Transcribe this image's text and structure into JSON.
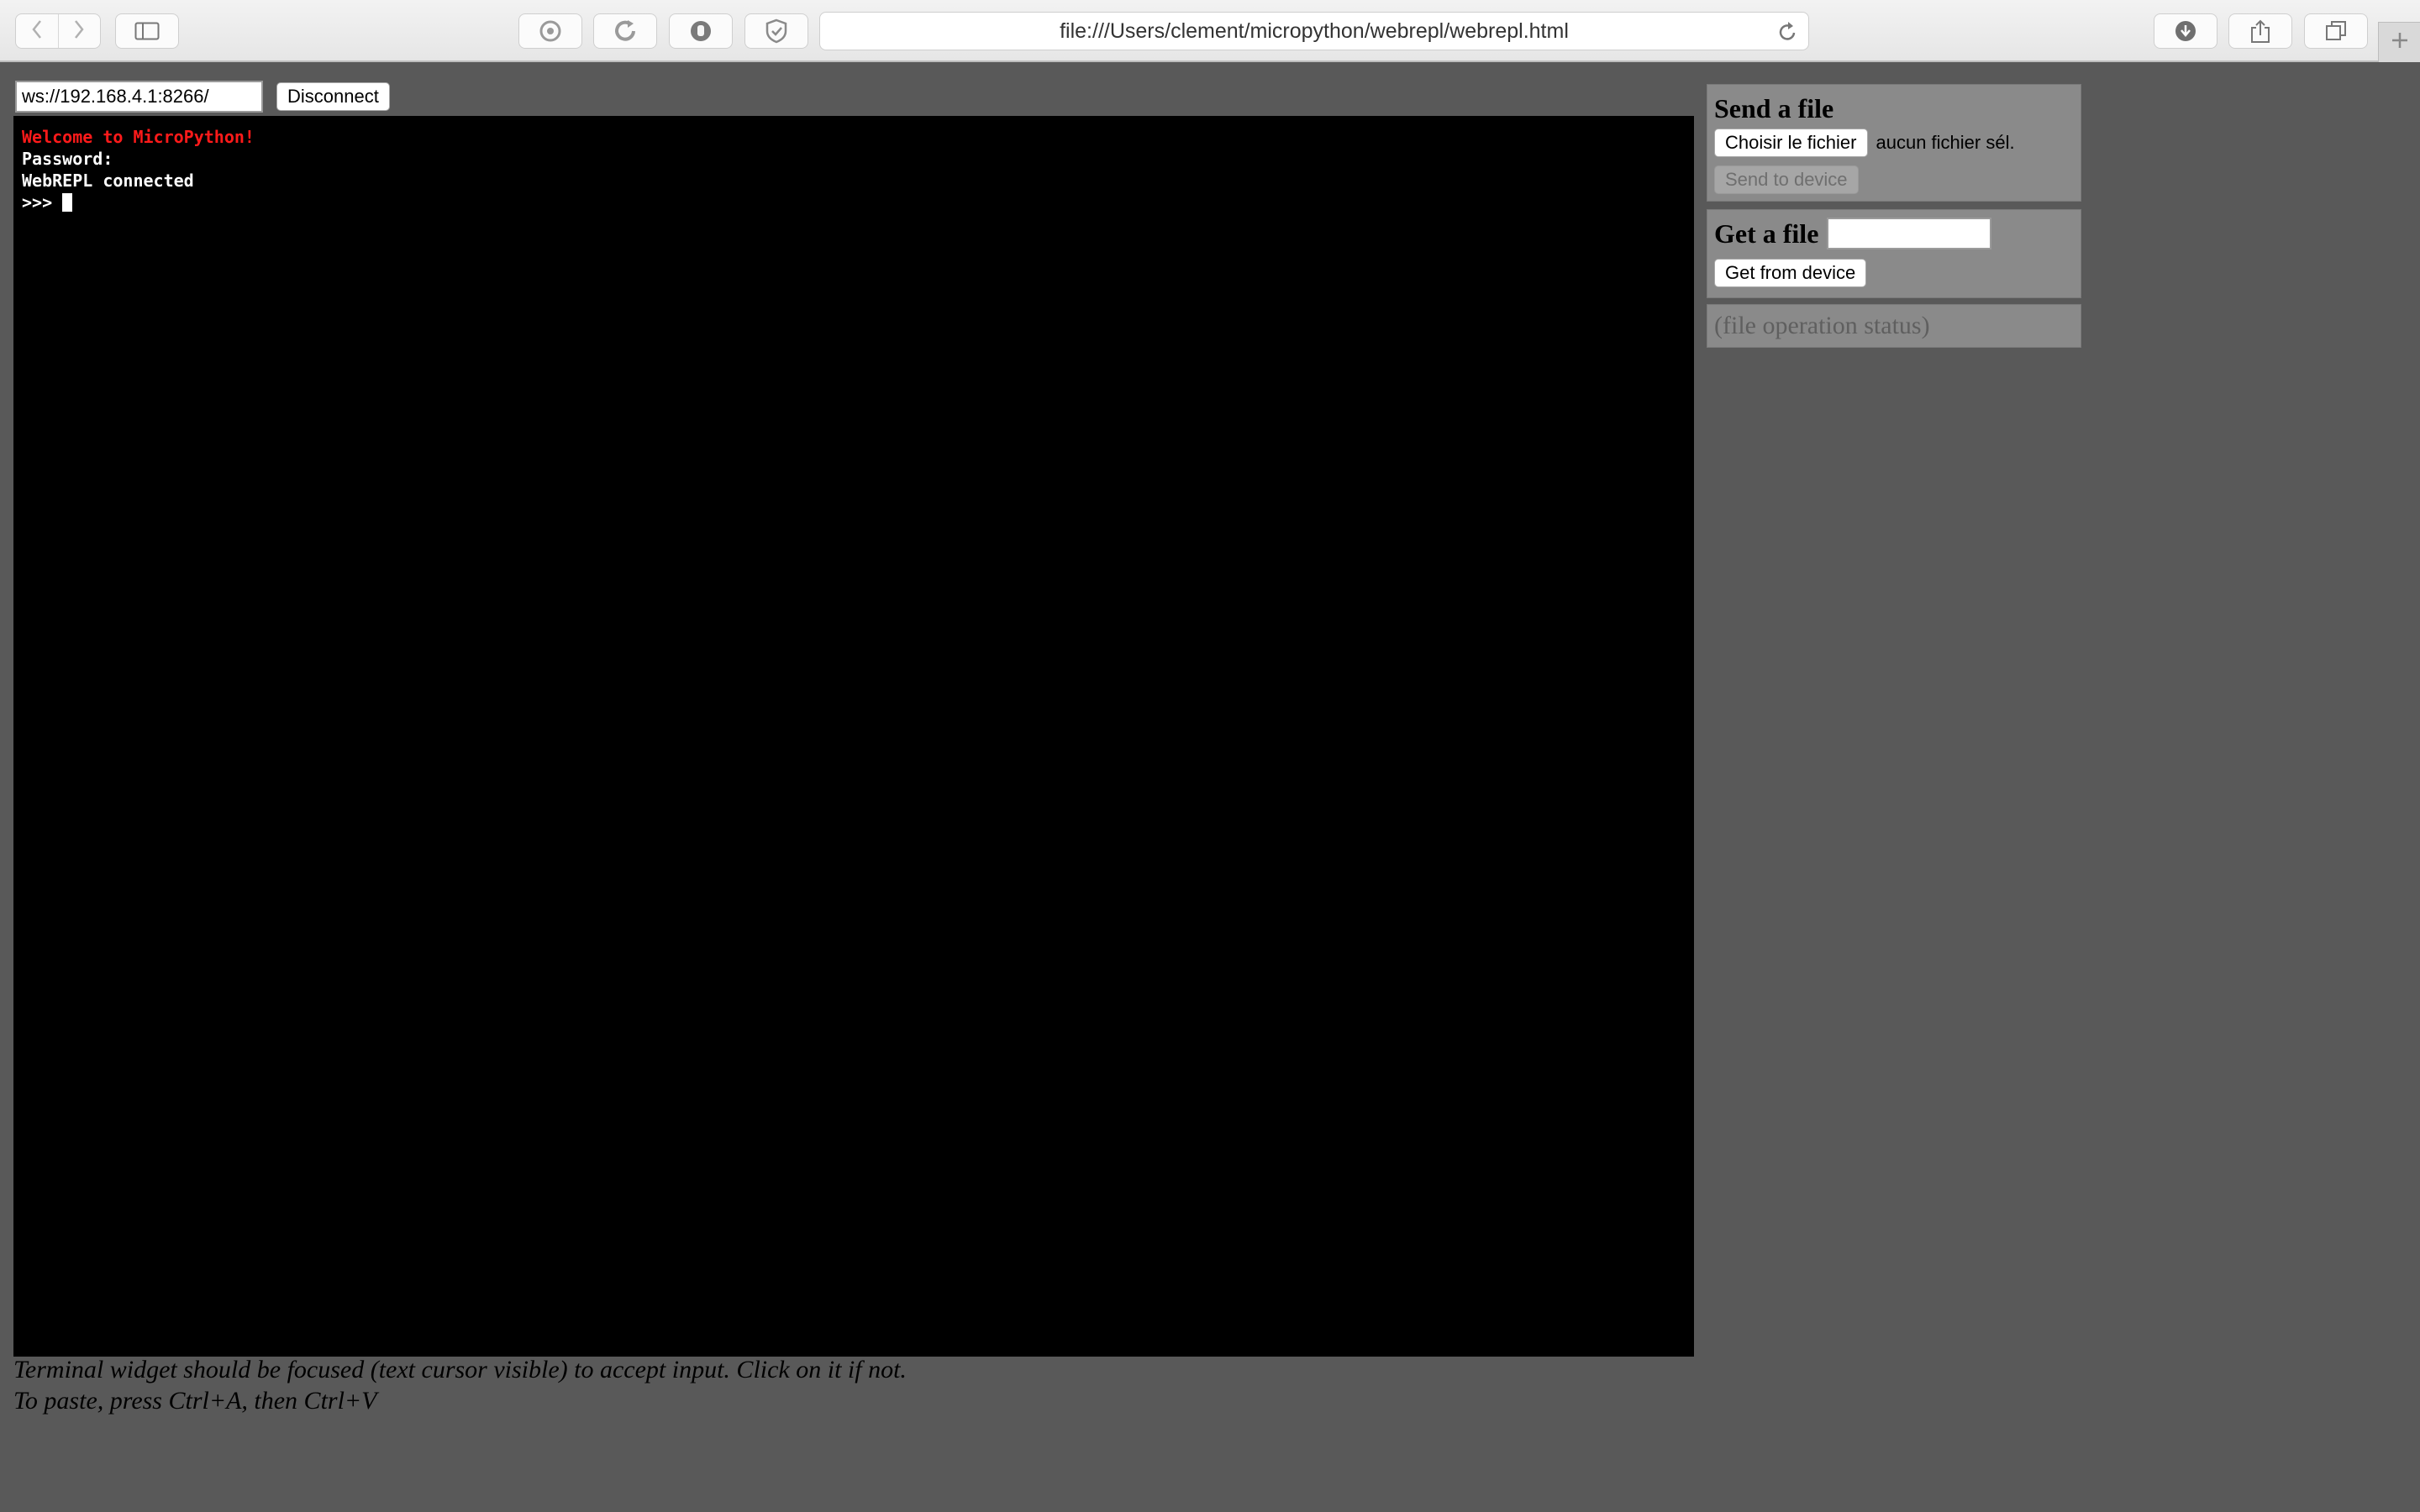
{
  "browser": {
    "url": "file:///Users/clement/micropython/webrepl/webrepl.html",
    "toolbar_icons": {
      "back": "chevron-left-icon",
      "forward": "chevron-right-icon",
      "sidebar": "sidebar-icon",
      "ext1": "target-icon",
      "ext2": "refresh-circle-icon",
      "ext3": "hand-icon",
      "ext4": "shield-icon",
      "reload": "reload-icon",
      "download": "download-icon",
      "share": "share-icon",
      "tabs": "tabs-icon",
      "new_tab": "plus-icon"
    }
  },
  "connection": {
    "ws_url": "ws://192.168.4.1:8266/",
    "connect_button_label": "Disconnect"
  },
  "terminal": {
    "lines": [
      "Welcome to MicroPython!",
      "Password:",
      "WebREPL connected",
      ">>> "
    ],
    "colors": {
      "welcome": "#ff1a1a",
      "text": "#ffffff",
      "background": "#000000"
    }
  },
  "notes": {
    "line1": "Terminal widget should be focused (text cursor visible) to accept input. Click on it if not.",
    "line2": "To paste, press Ctrl+A, then Ctrl+V"
  },
  "send_file": {
    "title": "Send a file",
    "choose_label": "Choisir le fichier",
    "no_file_text": "aucun fichier sél.",
    "send_button_label": "Send to device"
  },
  "get_file": {
    "title": "Get a file",
    "filename_value": "",
    "get_button_label": "Get from device"
  },
  "status": {
    "text": "(file operation status)"
  }
}
